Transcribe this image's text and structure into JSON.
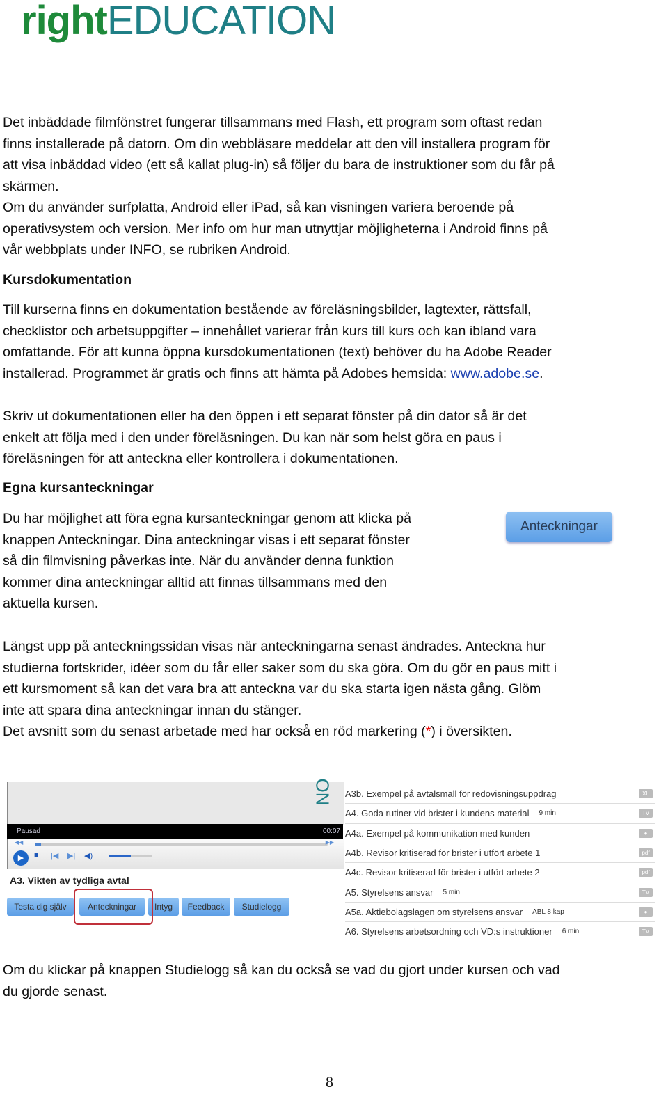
{
  "logo": {
    "part1": "right",
    "part2": "EDUCATION"
  },
  "p1": [
    "Det inbäddade filmfönstret fungerar tillsammans med Flash, ett program som oftast redan",
    "finns installerade på datorn. Om din webbläsare meddelar att den vill installera program för",
    "att visa inbäddad video (ett så kallat plug-in) så följer du bara de instruktioner som du får på",
    "skärmen.",
    "Om du använder surfplatta, Android eller iPad, så kan visningen variera beroende på",
    "operativsystem och version. Mer info om hur man utnyttjar möjligheterna i Android finns på",
    "vår webbplats under INFO, se rubriken Android."
  ],
  "h1": "Kursdokumentation",
  "p2": [
    "Till kurserna finns en dokumentation bestående av föreläsningsbilder, lagtexter, rättsfall,",
    "checklistor och arbetsuppgifter – innehållet varierar från kurs till kurs och kan ibland vara",
    "omfattande. För att kunna öppna kursdokumentationen (text) behöver du ha Adobe Reader"
  ],
  "p2_last": {
    "before": "installerad. Programmet är gratis och finns att hämta på Adobes hemsida: ",
    "link": "www.adobe.se",
    "after": "."
  },
  "p3": [
    "Skriv ut dokumentationen eller ha den öppen i ett separat fönster på din dator så är det",
    "enkelt att följa med i den under föreläsningen. Du kan när som helst göra en paus i",
    "föreläsningen för att anteckna eller kontrollera i dokumentationen."
  ],
  "h2": "Egna kursanteckningar",
  "p4": [
    "Du har möjlighet att föra egna kursanteckningar genom att klicka på",
    "knappen Anteckningar. Dina anteckningar visas i ett separat fönster",
    "så din filmvisning påverkas inte. När du använder denna funktion",
    "kommer dina anteckningar alltid att finnas tillsammans med den",
    "aktuella kursen."
  ],
  "notes_button": "Anteckningar",
  "p5": [
    "Längst upp på anteckningssidan visas när anteckningarna senast ändrades. Anteckna hur",
    "studierna fortskrider, idéer som du får eller saker som du ska göra. Om du gör en paus mitt i",
    "ett kursmoment så kan det vara bra att anteckna var du ska starta igen nästa gång. Glöm",
    "inte att spara dina anteckningar innan du stänger."
  ],
  "p5_last": {
    "before": "Det avsnitt som du senast arbetade med har också en röd markering (",
    "mark": "*",
    "after": ") i översikten."
  },
  "inset": {
    "video_logo": "ON",
    "status": "Pausad",
    "time": "00:07",
    "volume_level": 0.5,
    "progress": 0.02,
    "title": "A3. Vikten av tydliga avtal",
    "buttons": [
      "Testa dig själv",
      "Anteckningar",
      "Intyg",
      "Feedback",
      "Studielogg"
    ],
    "highlight_color": "#c0303a",
    "list": [
      {
        "title": "A3b. Exempel på avtalsmall för redovisningsuppdrag",
        "detail": "",
        "badge": "XL"
      },
      {
        "title": "A4. Goda rutiner vid brister i kundens material",
        "detail": "9 min",
        "badge": "TV"
      },
      {
        "title": "A4a. Exempel på kommunikation med kunden",
        "detail": "",
        "badge": "●"
      },
      {
        "title": "A4b. Revisor kritiserad för brister i utfört arbete 1",
        "detail": "",
        "badge": "pdf"
      },
      {
        "title": "A4c. Revisor kritiserad för brister i utfört arbete 2",
        "detail": "",
        "badge": "pdf"
      },
      {
        "title": "A5. Styrelsens ansvar",
        "detail": "5 min",
        "badge": "TV"
      },
      {
        "title": "A5a. Aktiebolagslagen om styrelsens ansvar",
        "detail": "ABL 8 kap",
        "badge": "●"
      },
      {
        "title": "A6. Styrelsens arbetsordning och VD:s instruktioner",
        "detail": "6 min",
        "badge": "TV"
      }
    ]
  },
  "p6": [
    "Om du klickar på knappen Studielogg så kan du också se vad du gjort under kursen och vad",
    "du gjorde senast."
  ],
  "page_number": "8"
}
